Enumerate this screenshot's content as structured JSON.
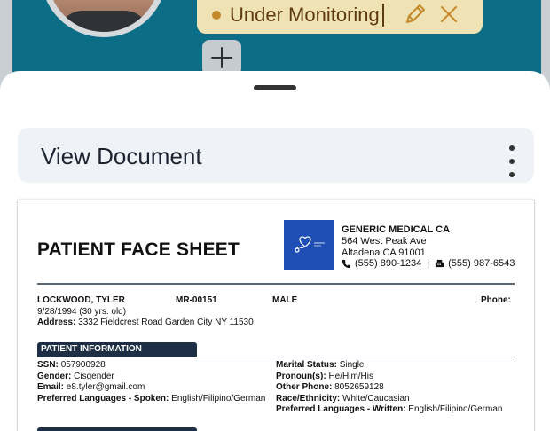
{
  "header": {
    "status_label": "Under Monitoring",
    "status_color": "#c48a2a"
  },
  "sheet": {
    "title": "View Document"
  },
  "document": {
    "heading": "PATIENT FACE SHEET",
    "org": {
      "name": "GENERIC MEDICAL CA",
      "address_line1": "564 West Peak Ave",
      "address_line2": "Altadena CA 91001",
      "phone": "(555) 890-1234",
      "separator": "|",
      "fax": "(555) 987-6543"
    },
    "patient": {
      "name": "LOCKWOOD, TYLER",
      "mrn": "MR-00151",
      "sex": "MALE",
      "phone_label": "Phone:",
      "dob": "9/28/1994 (30 yrs. old)",
      "address_label": "Address:",
      "address": "3332 Fieldcrest Road Garden City NY 11530"
    },
    "section_title": "PATIENT INFORMATION",
    "info_left": [
      {
        "label": "SSN:",
        "value": "057900928"
      },
      {
        "label": "Gender:",
        "value": "Cisgender"
      },
      {
        "label": "Email:",
        "value": "e8.tyler@gmail.com"
      },
      {
        "label": "Preferred Languages - Spoken:",
        "value": "English/Filipino/German"
      }
    ],
    "info_right": [
      {
        "label": "Marital Status:",
        "value": "Single"
      },
      {
        "label": "Pronoun(s):",
        "value": "He/Him/His"
      },
      {
        "label": "Other Phone:",
        "value": "8052659128"
      },
      {
        "label": "Race/Ethnicity:",
        "value": "White/Caucasian"
      },
      {
        "label": "Preferred Languages - Written:",
        "value": "English/Filipino/German"
      }
    ]
  },
  "icons": [
    "edit-pencil-icon",
    "close-x-icon",
    "plus-icon",
    "more-vertical-icon",
    "phone-icon",
    "fax-icon",
    "medical-logo-icon"
  ],
  "colors": {
    "teal_background": "#0b6d86",
    "status_pill": "#efe2b4",
    "section_tab": "#1e2f45",
    "logo_blue": "#1f4fb4"
  }
}
